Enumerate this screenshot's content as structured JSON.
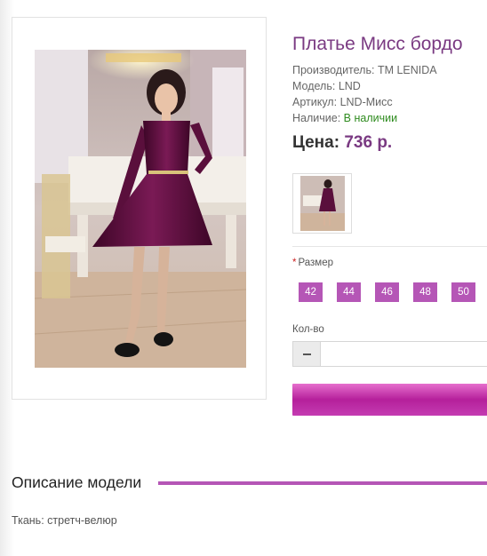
{
  "product": {
    "title": "Платье Мисс бордо",
    "manufacturer_label": "Производитель:",
    "manufacturer_value": "ТМ LENIDA",
    "model_label": "Модель:",
    "model_value": "LND",
    "sku_label": "Артикул:",
    "sku_value": "LND-Мисс",
    "availability_label": "Наличие:",
    "availability_value": "В наличии",
    "price_label": "Цена:",
    "price_value": "736 р."
  },
  "options": {
    "size_required_mark": "*",
    "size_label": "Размер",
    "sizes": [
      "42",
      "44",
      "46",
      "48",
      "50"
    ]
  },
  "quantity": {
    "label": "Кол-во",
    "value": ""
  },
  "description": {
    "heading": "Описание модели",
    "text": "Ткань: стретч-велюр"
  },
  "colors": {
    "accent": "#b556b6",
    "title": "#7a3a82",
    "in_stock": "#2e8b1e",
    "dress": "#5a0f3c"
  }
}
